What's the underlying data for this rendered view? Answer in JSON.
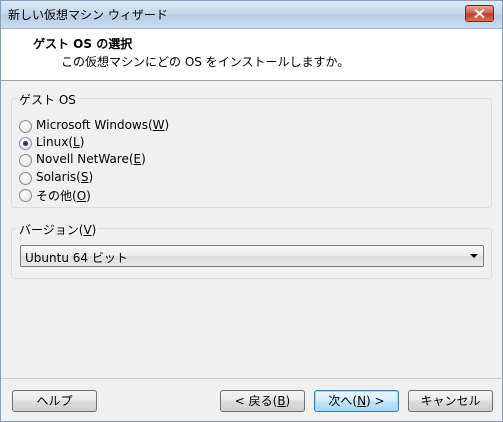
{
  "window": {
    "title": "新しい仮想マシン ウィザード",
    "close_icon": "close-icon"
  },
  "header": {
    "title": "ゲスト OS の選択",
    "subtitle": "この仮想マシンにどの OS をインストールしますか。"
  },
  "guest_os": {
    "group_label": "ゲスト OS",
    "options": [
      {
        "label": "Microsoft Windows(",
        "mnemonic": "W",
        "suffix": ")",
        "selected": false
      },
      {
        "label": "Linux(",
        "mnemonic": "L",
        "suffix": ")",
        "selected": true
      },
      {
        "label": "Novell NetWare(",
        "mnemonic": "E",
        "suffix": ")",
        "selected": false
      },
      {
        "label": "Solaris(",
        "mnemonic": "S",
        "suffix": ")",
        "selected": false
      },
      {
        "label": "その他(",
        "mnemonic": "O",
        "suffix": ")",
        "selected": false
      }
    ]
  },
  "version": {
    "group_label_prefix": "バージョン(",
    "group_label_mnemonic": "V",
    "group_label_suffix": ")",
    "selected": "Ubuntu 64 ビット"
  },
  "buttons": {
    "help": "ヘルプ",
    "back_prefix": "< 戻る(",
    "back_mnemonic": "B",
    "back_suffix": ")",
    "next_prefix": "次へ(",
    "next_mnemonic": "N",
    "next_suffix": ") >",
    "cancel": "キャンセル"
  }
}
